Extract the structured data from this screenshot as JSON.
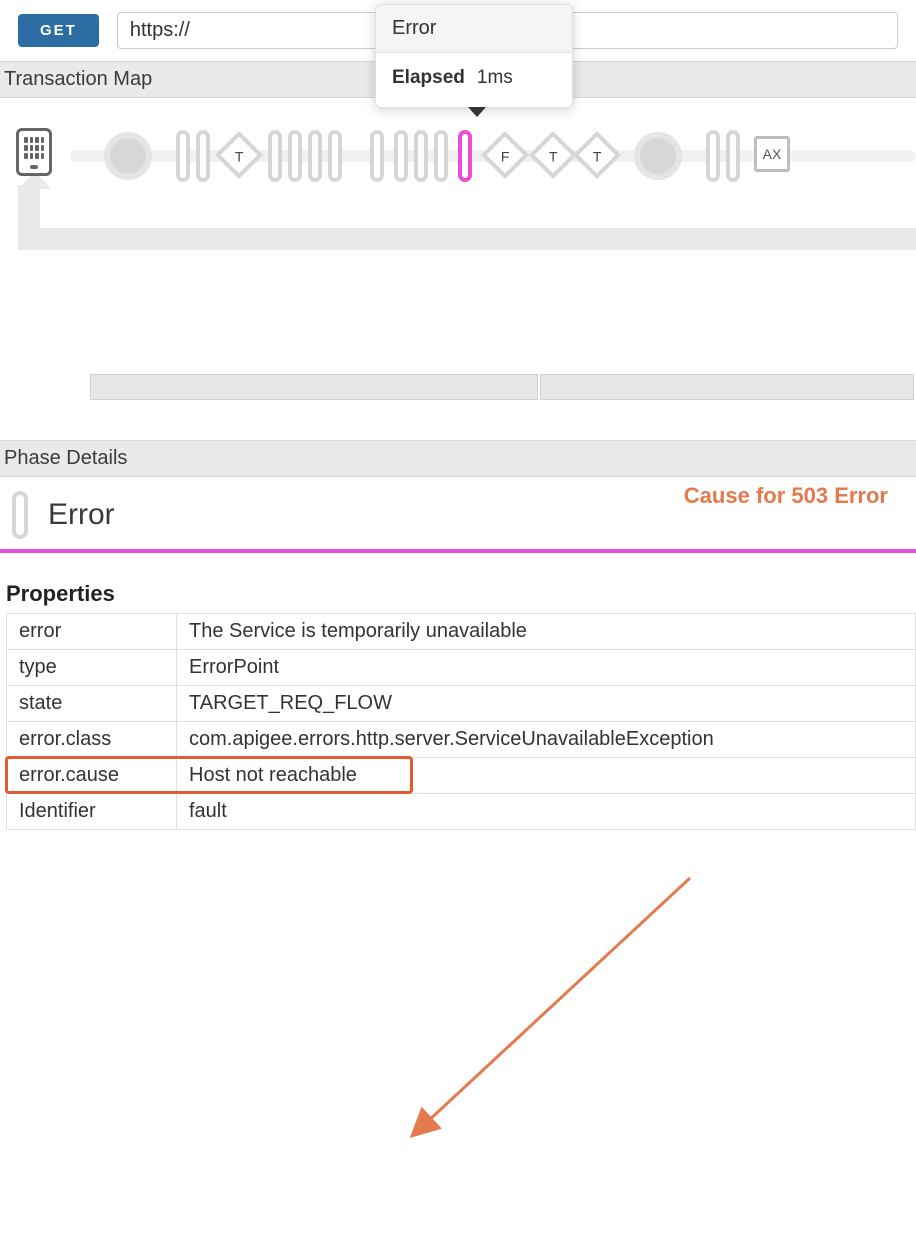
{
  "request": {
    "method": "GET",
    "url_prefix": "https://"
  },
  "tooltip": {
    "title": "Error",
    "elapsed_label": "Elapsed",
    "elapsed_value": "1ms"
  },
  "sections": {
    "transaction_map": "Transaction Map",
    "phase_details": "Phase Details"
  },
  "tmap": {
    "diamond_labels": [
      "T",
      "F",
      "T",
      "T"
    ],
    "square_label": "AX"
  },
  "phase": {
    "title": "Error"
  },
  "annotation": {
    "text": "Cause for 503 Error"
  },
  "properties": {
    "heading": "Properties",
    "rows": [
      {
        "key": "error",
        "value": "The Service is temporarily unavailable"
      },
      {
        "key": "type",
        "value": "ErrorPoint"
      },
      {
        "key": "state",
        "value": "TARGET_REQ_FLOW"
      },
      {
        "key": "error.class",
        "value": "com.apigee.errors.http.server.ServiceUnavailableException"
      },
      {
        "key": "error.cause",
        "value": "Host not reachable"
      },
      {
        "key": "Identifier",
        "value": "fault"
      }
    ],
    "highlight_index": 4
  }
}
